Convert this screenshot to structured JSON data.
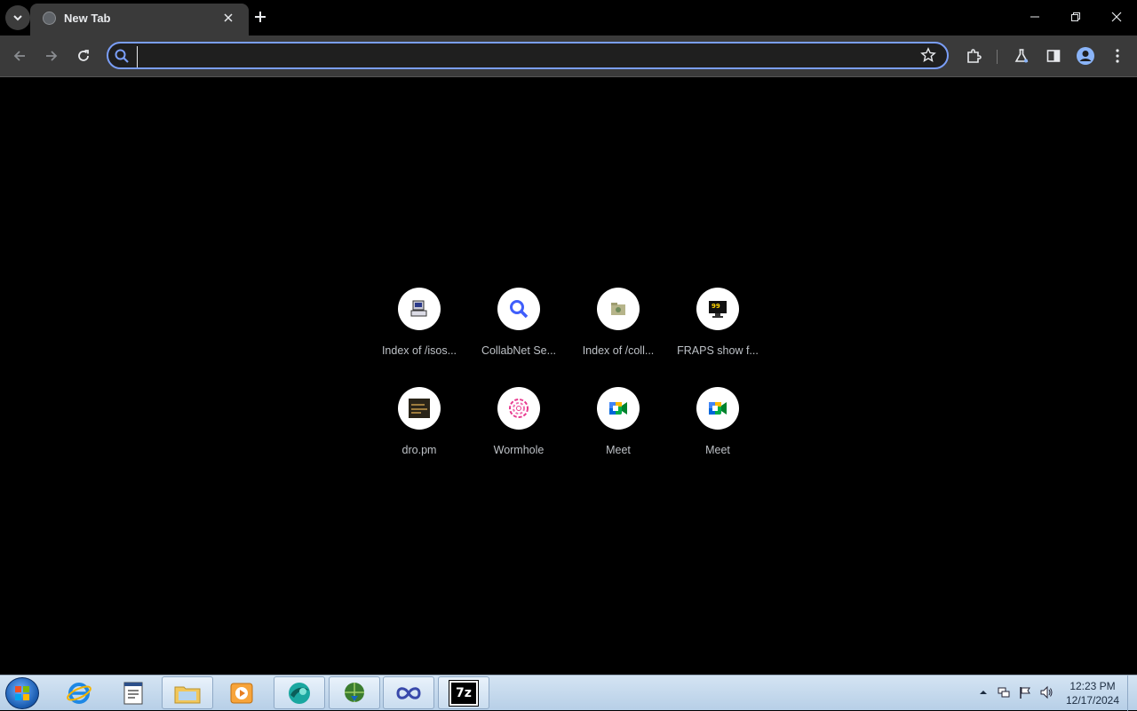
{
  "browser": {
    "tab_title": "New Tab",
    "omnibox_value": "",
    "omnibox_placeholder": ""
  },
  "shortcuts": [
    {
      "label": "Index of /isos...",
      "icon": "computer-icon"
    },
    {
      "label": "CollabNet Se...",
      "icon": "magnifier-icon"
    },
    {
      "label": "Index of /coll...",
      "icon": "folder-icon"
    },
    {
      "label": "FRAPS show f...",
      "icon": "fraps-icon"
    },
    {
      "label": "dro.pm",
      "icon": "dro-icon"
    },
    {
      "label": "Wormhole",
      "icon": "wormhole-icon"
    },
    {
      "label": "Meet",
      "icon": "google-meet-icon"
    },
    {
      "label": "Meet",
      "icon": "google-meet-icon"
    }
  ],
  "taskbar": {
    "apps": [
      "internet-explorer-icon",
      "document-icon",
      "file-explorer-icon",
      "media-player-icon",
      "browser-app-icon",
      "download-manager-icon",
      "infinity-app-icon",
      "7zip-icon"
    ],
    "seven_zip_label": "7z",
    "clock_time": "12:23 PM",
    "clock_date": "12/17/2024"
  },
  "colors": {
    "page_background": "#000000",
    "toolbar": "#3a3a3a",
    "omnibox_focus": "#7a9ef7",
    "taskbar": "#c5d8ec"
  }
}
